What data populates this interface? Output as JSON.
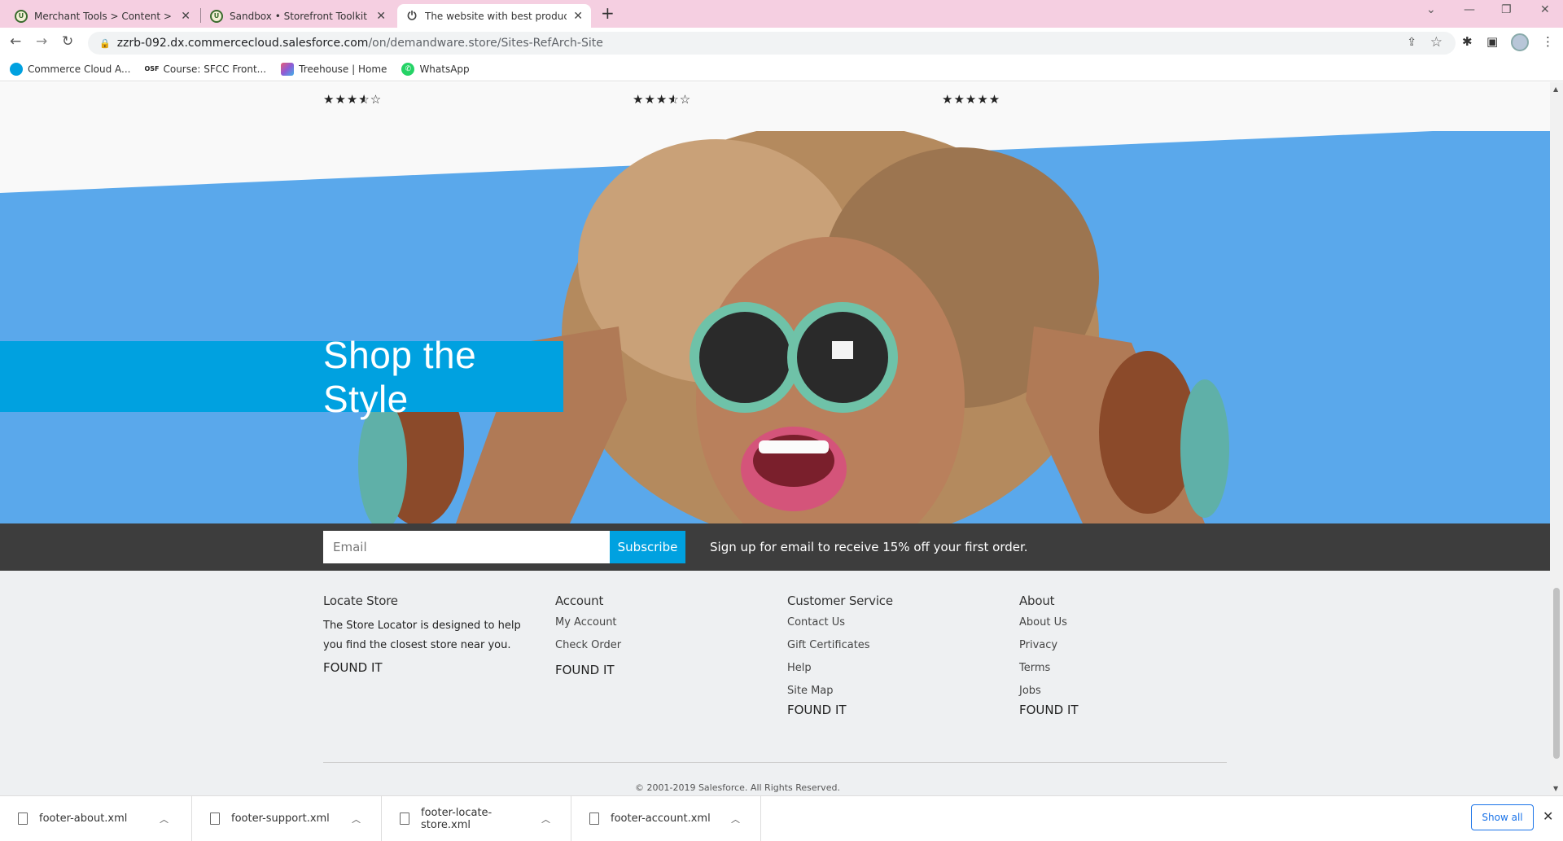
{
  "browser": {
    "tabs": [
      {
        "title": "Merchant Tools > Content > Co",
        "close": "✕"
      },
      {
        "title": "Sandbox • Storefront Toolkit • Bu",
        "close": "✕"
      },
      {
        "title": "The website with best products a",
        "close": "✕"
      }
    ],
    "new_tab": "+",
    "address": {
      "host": "zzrb-092.dx.commercecloud.salesforce.com",
      "path": "/on/demandware.store/Sites-RefArch-Site"
    },
    "bookmarks": [
      {
        "label": "Commerce Cloud A...",
        "icon": "salesforce-cloud-icon",
        "color": "#00a1e0"
      },
      {
        "label": "Course: SFCC Front...",
        "icon": "osf-icon",
        "color": "#222222"
      },
      {
        "label": "Treehouse | Home",
        "icon": "treehouse-icon",
        "color": "#8e5bd6"
      },
      {
        "label": "WhatsApp",
        "icon": "whatsapp-icon",
        "color": "#25d366"
      }
    ]
  },
  "products": {
    "ratings": [
      3.5,
      3.5,
      5
    ]
  },
  "hero": {
    "banner_text": "Shop the Style",
    "accent_color": "#00a1e0",
    "background_color": "#5aa8eb"
  },
  "signup": {
    "email_placeholder": "Email",
    "subscribe_label": "Subscribe",
    "promo_text": "Sign up for email to receive 15% off your first order."
  },
  "footer": {
    "locate_store": {
      "heading": "Locate Store",
      "text": "The Store Locator is designed to help you find the closest store near you.",
      "found": "FOUND IT"
    },
    "account": {
      "heading": "Account",
      "links": [
        "My Account",
        "Check Order"
      ],
      "found": "FOUND IT"
    },
    "customer_service": {
      "heading": "Customer Service",
      "links": [
        "Contact Us",
        "Gift Certificates",
        "Help",
        "Site Map"
      ],
      "found": "FOUND IT"
    },
    "about": {
      "heading": "About",
      "links": [
        "About Us",
        "Privacy",
        "Terms",
        "Jobs"
      ],
      "found": "FOUND IT"
    },
    "copyright": "© 2001-2019 Salesforce. All Rights Reserved."
  },
  "downloads": {
    "items": [
      "footer-about.xml",
      "footer-support.xml",
      "footer-locate-store.xml",
      "footer-account.xml"
    ],
    "show_all": "Show all"
  }
}
